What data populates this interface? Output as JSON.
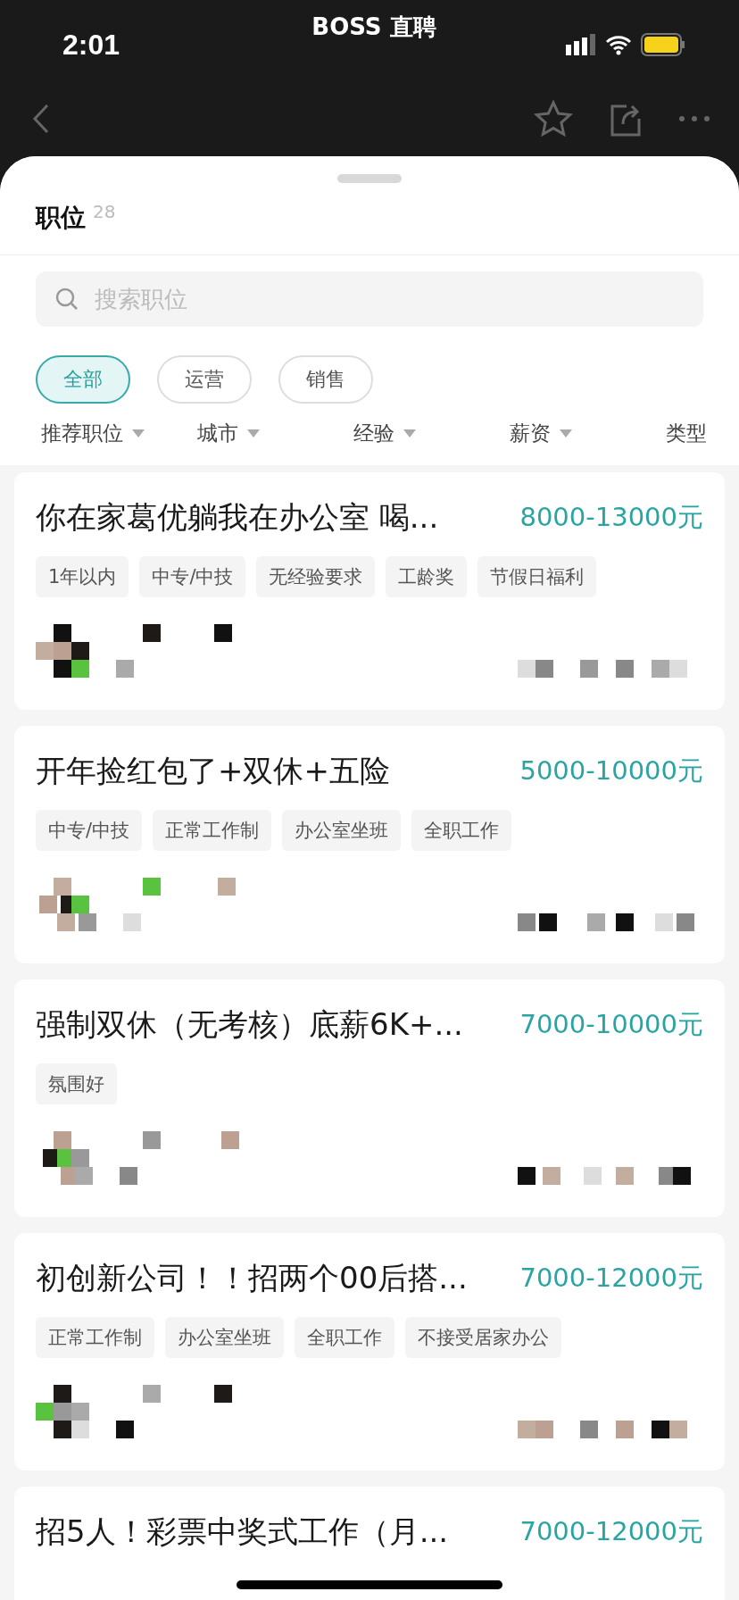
{
  "status_bar": {
    "time": "2:01",
    "carrier": "BOSS 直聘"
  },
  "sheet": {
    "title": "职位",
    "count": "28"
  },
  "search": {
    "placeholder": "搜索职位"
  },
  "chips": [
    {
      "label": "全部",
      "selected": true
    },
    {
      "label": "运营",
      "selected": false
    },
    {
      "label": "销售",
      "selected": false
    }
  ],
  "filters": [
    {
      "label": "推荐职位",
      "dropdown": true
    },
    {
      "label": "城市",
      "dropdown": true
    },
    {
      "label": "经验",
      "dropdown": true
    },
    {
      "label": "薪资",
      "dropdown": true
    },
    {
      "label": "类型",
      "dropdown": false
    }
  ],
  "jobs": [
    {
      "title": "你在家葛优躺我在办公室 喝...",
      "salary": "8000-13000元",
      "tags": [
        "1年以内",
        "中专/中技",
        "无经验要求",
        "工龄奖",
        "节假日福利"
      ]
    },
    {
      "title": "开年捡红包了+双休+五险",
      "salary": "5000-10000元",
      "tags": [
        "中专/中技",
        "正常工作制",
        "办公室坐班",
        "全职工作"
      ]
    },
    {
      "title": "强制双休（无考核）底薪6K+...",
      "salary": "7000-10000元",
      "tags": [
        "氛围好"
      ]
    },
    {
      "title": "初创新公司！！招两个00后搭...",
      "salary": "7000-12000元",
      "tags": [
        "正常工作制",
        "办公室坐班",
        "全职工作",
        "不接受居家办公"
      ]
    },
    {
      "title": "招5人！彩票中奖式工作（月...",
      "salary": "7000-12000元"
    }
  ]
}
